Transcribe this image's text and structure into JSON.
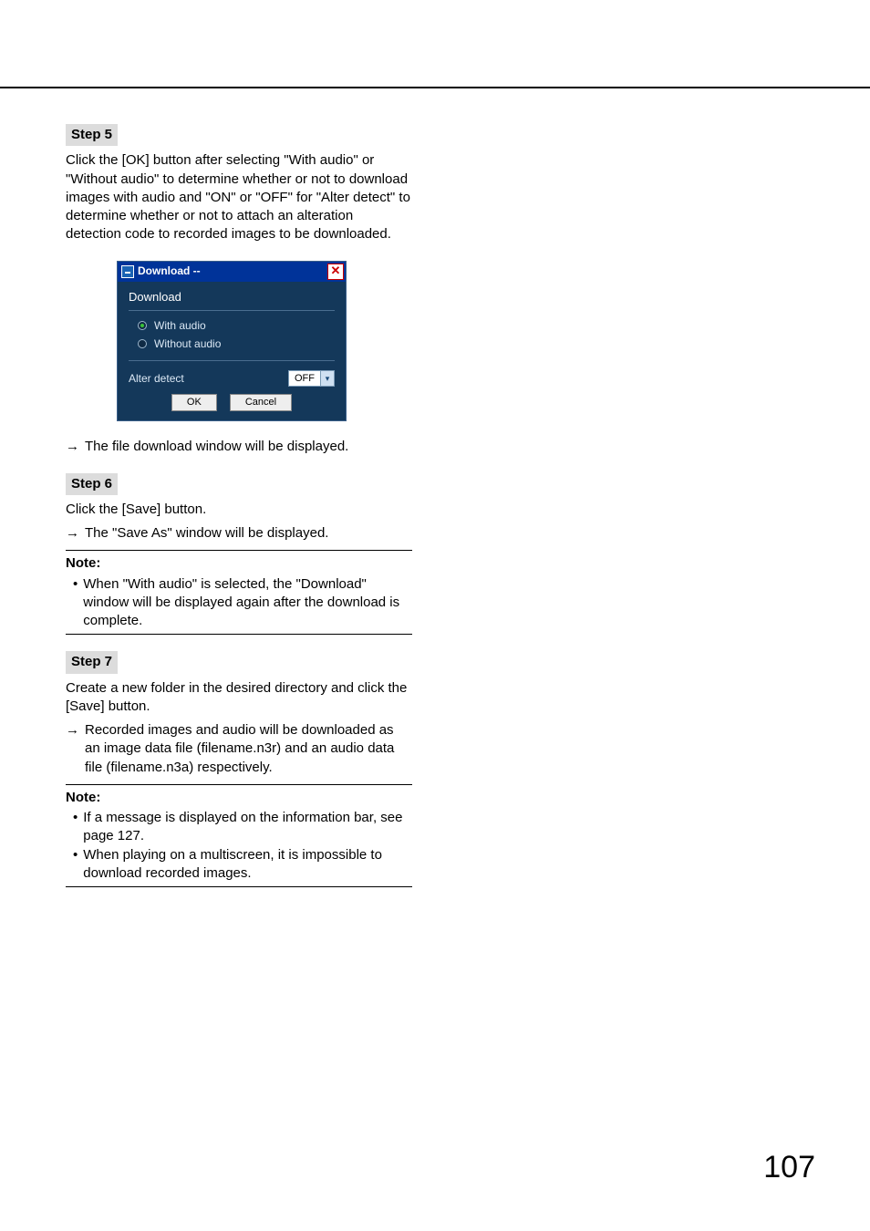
{
  "glyphs": {
    "arrow": "→"
  },
  "step5": {
    "label": "Step 5",
    "body": "Click the [OK] button after selecting \"With audio\" or \"Without audio\" to determine whether or not to download images with audio and \"ON\" or \"OFF\" for \"Alter detect\" to determine whether or not to attach an alteration detection code to recorded images to be downloaded.",
    "result": "The file download window will be displayed."
  },
  "dialog": {
    "title": "Download --",
    "close_glyph": "✕",
    "heading": "Download",
    "radio_with": "With audio",
    "radio_without": "Without audio",
    "alter_label": "Alter detect",
    "alter_value": "OFF",
    "ok": "OK",
    "cancel": "Cancel"
  },
  "step6": {
    "label": "Step 6",
    "body": "Click the [Save] button.",
    "result": "The \"Save As\" window will be displayed.",
    "note_title": "Note:",
    "note_items": [
      "When \"With audio\" is selected, the \"Download\" window will be displayed again after the download is complete."
    ]
  },
  "step7": {
    "label": "Step 7",
    "body": "Create a new folder in the desired directory and click the [Save] button.",
    "result": "Recorded images and audio will be downloaded as an image data file (filename.n3r) and an audio data file (filename.n3a) respectively.",
    "note_title": "Note:",
    "note_items": [
      "If a message is displayed on the information bar, see page 127.",
      "When playing on a multiscreen, it is impossible to download recorded images."
    ]
  },
  "page_number": "107"
}
